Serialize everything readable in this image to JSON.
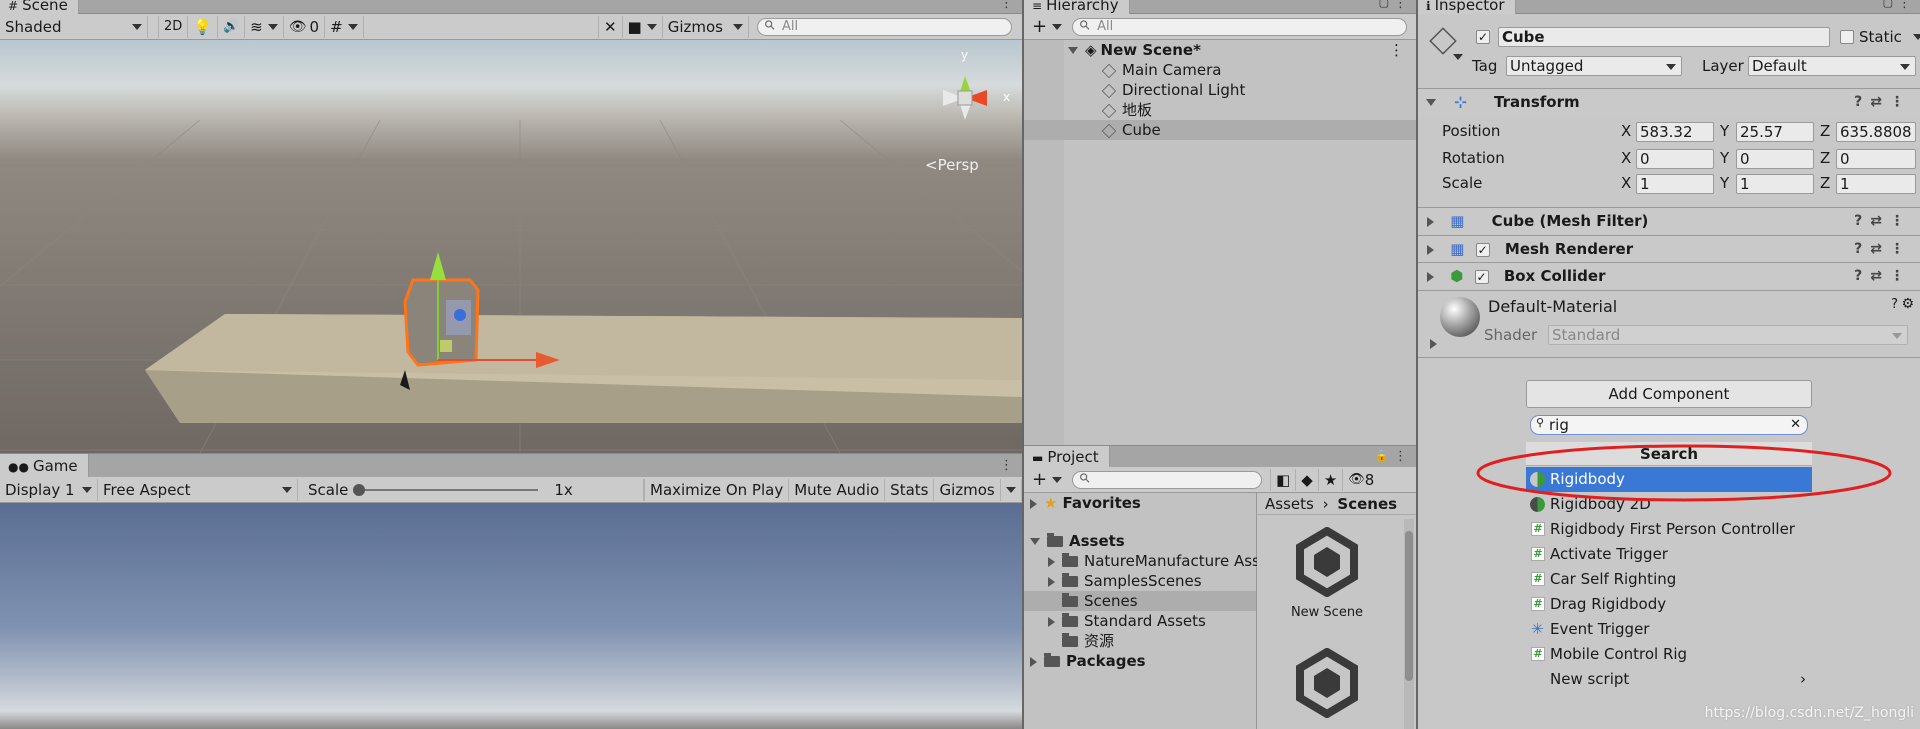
{
  "scene": {
    "tab_title": "Scene",
    "shading_mode": "Shaded",
    "btn_2d": "2D",
    "hidden_count": "0",
    "gizmos_label": "Gizmos",
    "search_placeholder": "All",
    "persp_label": "Persp",
    "axis_y": "y",
    "axis_x": "x"
  },
  "game": {
    "tab_title": "Game",
    "display": "Display 1",
    "aspect": "Free Aspect",
    "scale_label": "Scale",
    "scale_value": "1x",
    "maximize": "Maximize On Play",
    "mute": "Mute Audio",
    "stats": "Stats",
    "gizmos": "Gizmos"
  },
  "hierarchy": {
    "tab_title": "Hierarchy",
    "search_placeholder": "All",
    "scene_name": "New Scene*",
    "items": [
      "Main Camera",
      "Directional Light",
      "地板",
      "Cube"
    ]
  },
  "project": {
    "tab_title": "Project",
    "hidden_count": "8",
    "favorites": "Favorites",
    "assets": "Assets",
    "folders": [
      "NatureManufacture Ass",
      "SamplesScenes",
      "Scenes",
      "Standard Assets",
      "资源"
    ],
    "packages": "Packages",
    "breadcrumb_root": "Assets",
    "breadcrumb_current": "Scenes",
    "scene_asset": "New Scene"
  },
  "inspector": {
    "tab_title": "Inspector",
    "object_name": "Cube",
    "static_label": "Static",
    "tag_label": "Tag",
    "tag_value": "Untagged",
    "layer_label": "Layer",
    "layer_value": "Default",
    "transform": {
      "title": "Transform",
      "position_label": "Position",
      "rotation_label": "Rotation",
      "scale_label": "Scale",
      "position": {
        "x": "583.32",
        "y": "25.57",
        "z": "635.8808"
      },
      "rotation": {
        "x": "0",
        "y": "0",
        "z": "0"
      },
      "scale": {
        "x": "1",
        "y": "1",
        "z": "1"
      },
      "axis_x": "X",
      "axis_y": "Y",
      "axis_z": "Z"
    },
    "components": [
      "Cube (Mesh Filter)",
      "Mesh Renderer",
      "Box Collider"
    ],
    "material_name": "Default-Material",
    "shader_label": "Shader",
    "shader_value": "Standard",
    "add_component": "Add Component",
    "search_value": "rig",
    "search_header": "Search",
    "results": [
      "Rigidbody",
      "Rigidbody 2D",
      "Rigidbody First Person Controller",
      "Activate Trigger",
      "Car Self Righting",
      "Drag Rigidbody",
      "Event Trigger",
      "Mobile Control Rig",
      "New script"
    ],
    "selected_result": "Rigidbody"
  },
  "watermark": "https://blog.csdn.net/Z_hongli",
  "colors": {
    "selection": "#3a78d6",
    "highlight_ellipse": "#e02020",
    "panel_bg": "#c2c2c2"
  }
}
